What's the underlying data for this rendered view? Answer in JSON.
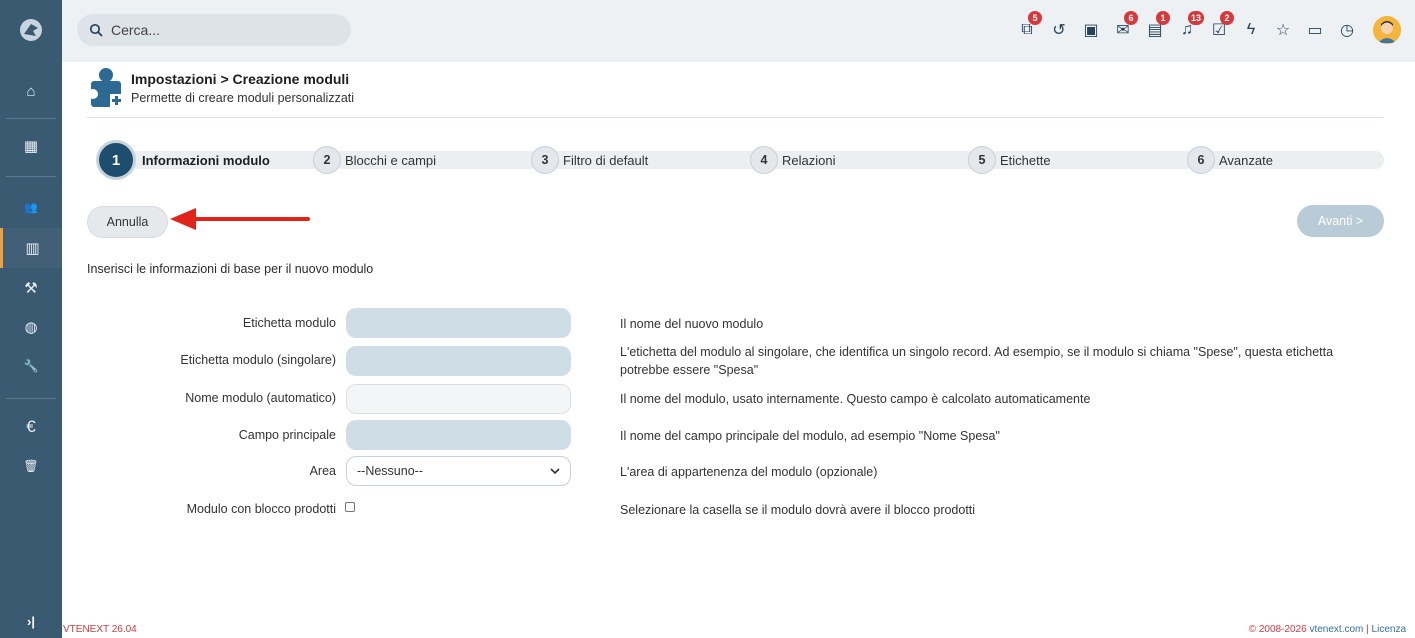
{
  "sidebar": {
    "items": [
      {
        "icon": "home-icon",
        "glyph": "⌂"
      },
      {
        "icon": "grid-icon",
        "glyph": "▦"
      },
      {
        "icon": "contacts-icon",
        "glyph": "👥"
      },
      {
        "icon": "building-icon",
        "glyph": "▥"
      },
      {
        "icon": "gavel-icon",
        "glyph": "⚒"
      },
      {
        "icon": "globe-icon",
        "glyph": "◍"
      },
      {
        "icon": "wrench-icon",
        "glyph": "🔧"
      },
      {
        "icon": "euro-icon",
        "glyph": "€"
      },
      {
        "icon": "trash-icon",
        "glyph": "🗑"
      }
    ],
    "collapse_glyph": "›|"
  },
  "topbar": {
    "search_placeholder": "Cerca...",
    "icons": [
      {
        "name": "process-icon",
        "glyph": "⧉",
        "badge": "5"
      },
      {
        "name": "history-icon",
        "glyph": "↺",
        "badge": ""
      },
      {
        "name": "calendar-icon",
        "glyph": "▣",
        "badge": ""
      },
      {
        "name": "mail-icon",
        "glyph": "✉",
        "badge": "6"
      },
      {
        "name": "chat-icon",
        "glyph": "▤",
        "badge": "1"
      },
      {
        "name": "bell-icon",
        "glyph": "♫",
        "badge": "13"
      },
      {
        "name": "todo-icon",
        "glyph": "☑",
        "badge": "2"
      },
      {
        "name": "flash-icon",
        "glyph": "ϟ",
        "badge": ""
      },
      {
        "name": "star-icon",
        "glyph": "☆",
        "badge": ""
      },
      {
        "name": "notes-icon",
        "glyph": "▭",
        "badge": ""
      },
      {
        "name": "timer-icon",
        "glyph": "◷",
        "badge": ""
      }
    ]
  },
  "header": {
    "title": "Impostazioni > Creazione moduli",
    "subtitle": "Permette di creare moduli personalizzati"
  },
  "steps": [
    {
      "num": "1",
      "label": "Informazioni modulo"
    },
    {
      "num": "2",
      "label": "Blocchi e campi"
    },
    {
      "num": "3",
      "label": "Filtro di default"
    },
    {
      "num": "4",
      "label": "Relazioni"
    },
    {
      "num": "5",
      "label": "Etichette"
    },
    {
      "num": "6",
      "label": "Avanzate"
    }
  ],
  "buttons": {
    "cancel": "Annulla",
    "next": "Avanti >"
  },
  "intro": "Inserisci le informazioni di base per il nuovo modulo",
  "form": {
    "rows": [
      {
        "label": "Etichetta modulo",
        "value": "",
        "help": "Il nome del nuovo modulo"
      },
      {
        "label": "Etichetta modulo (singolare)",
        "value": "",
        "help": "L'etichetta del modulo al singolare, che identifica un singolo record. Ad esempio, se il modulo si chiama \"Spese\", questa etichetta potrebbe essere \"Spesa\""
      },
      {
        "label": "Nome modulo (automatico)",
        "value": "",
        "help": "Il nome del modulo, usato internamente. Questo campo è calcolato automaticamente"
      },
      {
        "label": "Campo principale",
        "value": "",
        "help": "Il nome del campo principale del modulo, ad esempio \"Nome Spesa\""
      },
      {
        "label": "Area",
        "value": "--Nessuno--",
        "help": "L'area di appartenenza del modulo (opzionale)"
      },
      {
        "label": "Modulo con blocco prodotti",
        "value": false,
        "help": "Selezionare la casella se il modulo dovrà avere il blocco prodotti"
      }
    ]
  },
  "footer": {
    "version": "VTENEXT 26.04",
    "copyright": "© 2008-2026 ",
    "site": "vtenext.com",
    "separator": " | ",
    "license": "Licenza"
  },
  "colors": {
    "sidebar": "#3a5a72",
    "accent": "#1d4e6e",
    "badge": "#d9383a",
    "input": "#cfdde6",
    "arrow": "#e2231a"
  }
}
